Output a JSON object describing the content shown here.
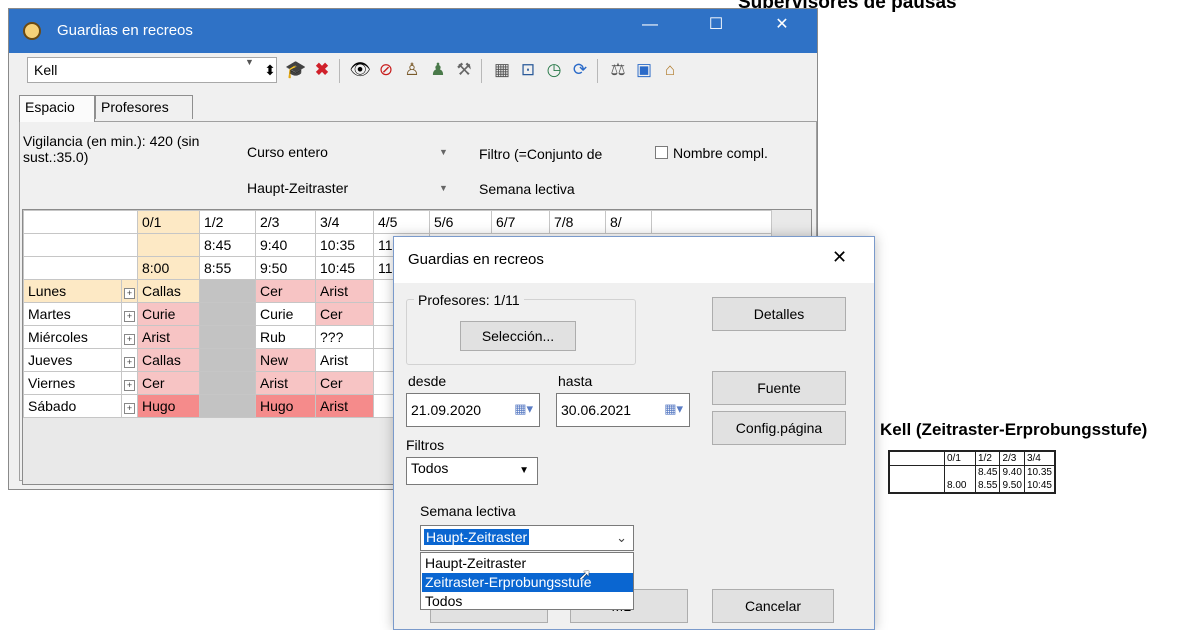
{
  "background_heading": "Supervisores de pausas",
  "main_window": {
    "title": "Guardias en recreos",
    "controls": {
      "minimize": "—",
      "maximize": "☐",
      "close": "✕"
    },
    "toolbar": {
      "teacher_value": "Kell",
      "icons": [
        "spin-icon",
        "graduation-cap-icon",
        "delete-icon",
        "eye-icon",
        "eye-hidden-icon",
        "people-icon",
        "people-config-icon",
        "tools-icon",
        "calculator-icon",
        "crop-icon",
        "clock-icon",
        "refresh-icon",
        "balance-icon",
        "window-icon",
        "teacher-portrait-icon"
      ]
    },
    "tabs": [
      "Espacio",
      "Profesores"
    ],
    "vigilancia": "Vigilancia (en min.): 420 (sin sust.:35.0)",
    "curso": "Curso entero",
    "zeitraster": "Haupt-Zeitraster",
    "filtro": "Filtro (=Conjunto de",
    "semana": "Semana lectiva",
    "nombre_compl": "Nombre compl.",
    "grid": {
      "header_row1": [
        "0/1",
        "1/2",
        "2/3",
        "3/4",
        "4/5",
        "5/6",
        "6/7",
        "7/8",
        "8/"
      ],
      "header_row2": [
        "",
        "8:45",
        "9:40",
        "10:35",
        "11"
      ],
      "header_row3": [
        "8:00",
        "8:55",
        "9:50",
        "10:45",
        "11"
      ],
      "days": [
        {
          "day": "Lunes",
          "c0": "Callas",
          "c2": "Cer",
          "c3": "Arist"
        },
        {
          "day": "Martes",
          "c0": "Curie",
          "c2": "Curie",
          "c3": "Cer"
        },
        {
          "day": "Miércoles",
          "c0": "Arist",
          "c2": "Rub",
          "c3": "???"
        },
        {
          "day": "Jueves",
          "c0": "Callas",
          "c2": "New",
          "c3": "Arist"
        },
        {
          "day": "Viernes",
          "c0": "Cer",
          "c2": "Arist",
          "c3": "Cer"
        },
        {
          "day": "Sábado",
          "c0": "Hugo",
          "c2": "Hugo",
          "c3": "Arist"
        }
      ]
    }
  },
  "dialog": {
    "title": "Guardias en recreos",
    "close": "✕",
    "profesores_label": "Profesores: 1/11",
    "seleccion": "Selección...",
    "detalles": "Detalles",
    "desde_label": "desde",
    "desde_value": "21.09.2020",
    "hasta_label": "hasta",
    "hasta_value": "30.06.2021",
    "fuente": "Fuente",
    "config_pagina": "Config.página",
    "filtros_label": "Filtros",
    "filtros_value": "Todos",
    "semana_label": "Semana lectiva",
    "semana_value": "Haupt-Zeitraster",
    "semana_options": [
      "Haupt-Zeitraster",
      "Zeitraster-Erprobungsstufe",
      "Todos"
    ],
    "html_btn_partial": "ML",
    "cancelar": "Cancelar"
  },
  "preview": {
    "title": "Kell (Zeitraster-Erprobungsstufe)",
    "header": [
      "0/1",
      "1/2",
      "2/3",
      "3/4"
    ],
    "row_top": [
      "",
      "8.45",
      "9.40",
      "10.35"
    ],
    "row_bottom": [
      "8.00",
      "8.55",
      "9.50",
      "10:45"
    ]
  }
}
